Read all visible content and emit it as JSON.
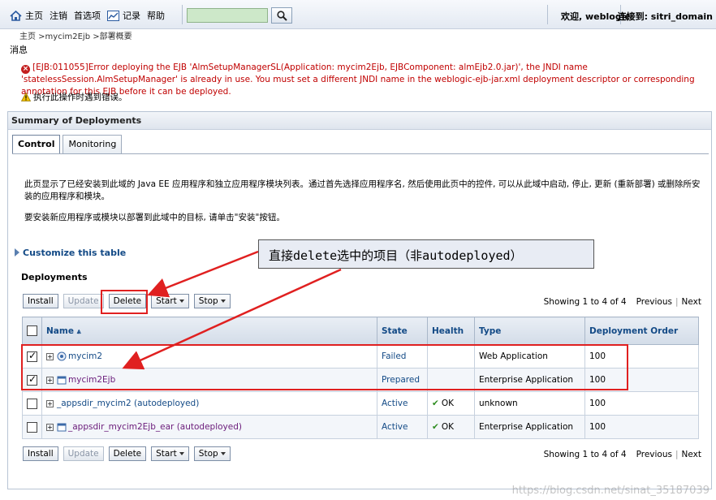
{
  "header": {
    "nav": [
      "主页",
      "注销",
      "首选项",
      "记录",
      "帮助"
    ],
    "search_value": "",
    "welcome": "欢迎, weblogic",
    "connected": "连接到: sitri_domain"
  },
  "breadcrumb": "主页 >mycim2Ejb >部署概要",
  "messages": {
    "title": "消息",
    "error": "[EJB:011055]Error deploying the EJB 'AlmSetupManagerSL(Application: mycim2Ejb, EJBComponent: almEjb2.0.jar)', the JNDI name 'statelessSession.AlmSetupManager' is already in use. You must set a different JNDI name in the weblogic-ejb-jar.xml deployment descriptor or corresponding annotation for this EJB before it can be deployed.",
    "warning": "执行此操作时遇到错误。"
  },
  "panel": {
    "title": "Summary of Deployments",
    "tabs": [
      "Control",
      "Monitoring"
    ],
    "description": "此页显示了已经安装到此域的 Java EE 应用程序和独立应用程序模块列表。通过首先选择应用程序名, 然后使用此页中的控件, 可以从此域中启动, 停止, 更新 (重新部署) 或删除所安装的应用程序和模块。",
    "install_hint": "要安装新应用程序或模块以部署到此域中的目标, 请单击\"安装\"按钮。",
    "customize": "Customize this table",
    "deployments_title": "Deployments"
  },
  "toolbar": {
    "install": "Install",
    "update": "Update",
    "delete": "Delete",
    "start": "Start",
    "stop": "Stop",
    "showing": "Showing 1 to 4 of 4",
    "previous": "Previous",
    "next": "Next"
  },
  "table": {
    "headers": [
      "Name",
      "State",
      "Health",
      "Type",
      "Deployment Order"
    ],
    "rows": [
      {
        "name": "mycim2",
        "state": "Failed",
        "health": "",
        "type": "Web Application",
        "order": "100",
        "checked": true
      },
      {
        "name": "mycim2Ejb",
        "state": "Prepared",
        "health": "",
        "type": "Enterprise Application",
        "order": "100",
        "checked": true
      },
      {
        "name": "_appsdir_mycim2 (autodeployed)",
        "state": "Active",
        "health": "OK",
        "type": "unknown",
        "order": "100",
        "checked": false
      },
      {
        "name": "_appsdir_mycim2Ejb_ear (autodeployed)",
        "state": "Active",
        "health": "OK",
        "type": "Enterprise Application",
        "order": "100",
        "checked": false
      }
    ]
  },
  "annotation": "直接delete选中的项目（非autodeployed）",
  "watermark": "https://blog.csdn.net/sinat_35187039",
  "colors": {
    "error": "#c00000",
    "link": "#134a86",
    "annotation": "#e02020"
  }
}
